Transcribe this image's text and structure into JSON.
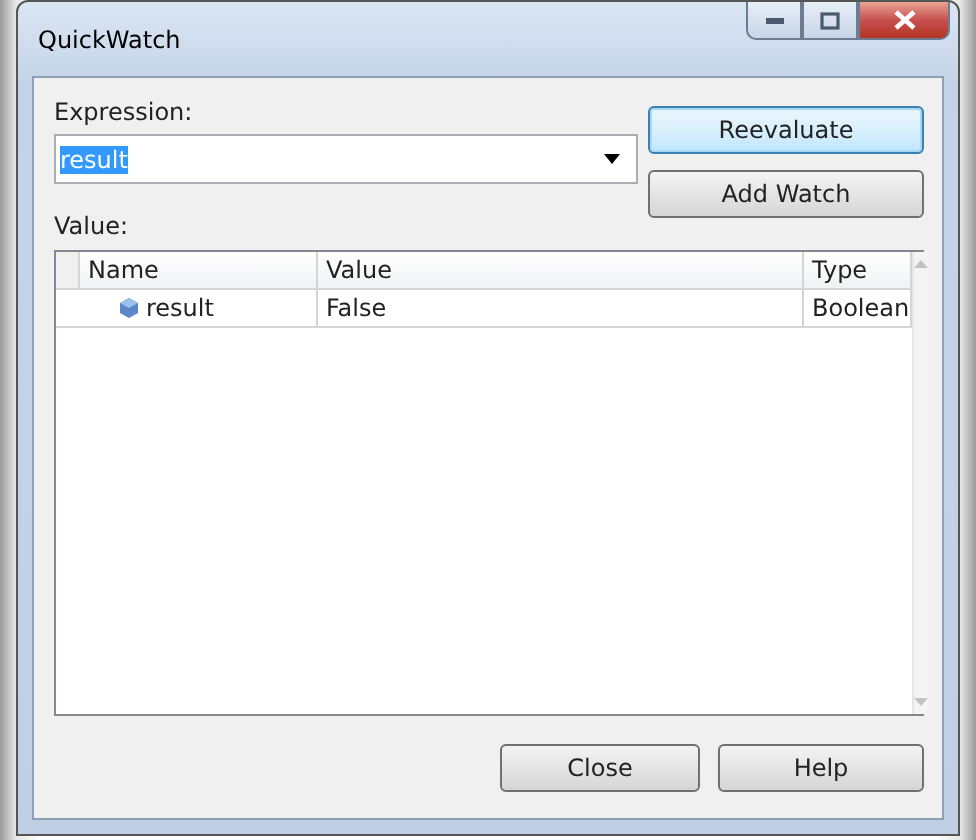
{
  "window": {
    "title": "QuickWatch"
  },
  "expression": {
    "label": "Expression:",
    "value": "result",
    "text_selected": true
  },
  "side_buttons": [
    {
      "label": "Reevaluate",
      "focused": true
    },
    {
      "label": "Add Watch",
      "focused": false
    }
  ],
  "value_label": "Value:",
  "grid": {
    "columns": [
      "Name",
      "Value",
      "Type"
    ],
    "rows": [
      {
        "name": "result",
        "value": "False",
        "type": "Boolean"
      }
    ]
  },
  "footer_buttons": [
    {
      "label": "Close",
      "focused": false
    },
    {
      "label": "Help",
      "focused": false
    }
  ]
}
